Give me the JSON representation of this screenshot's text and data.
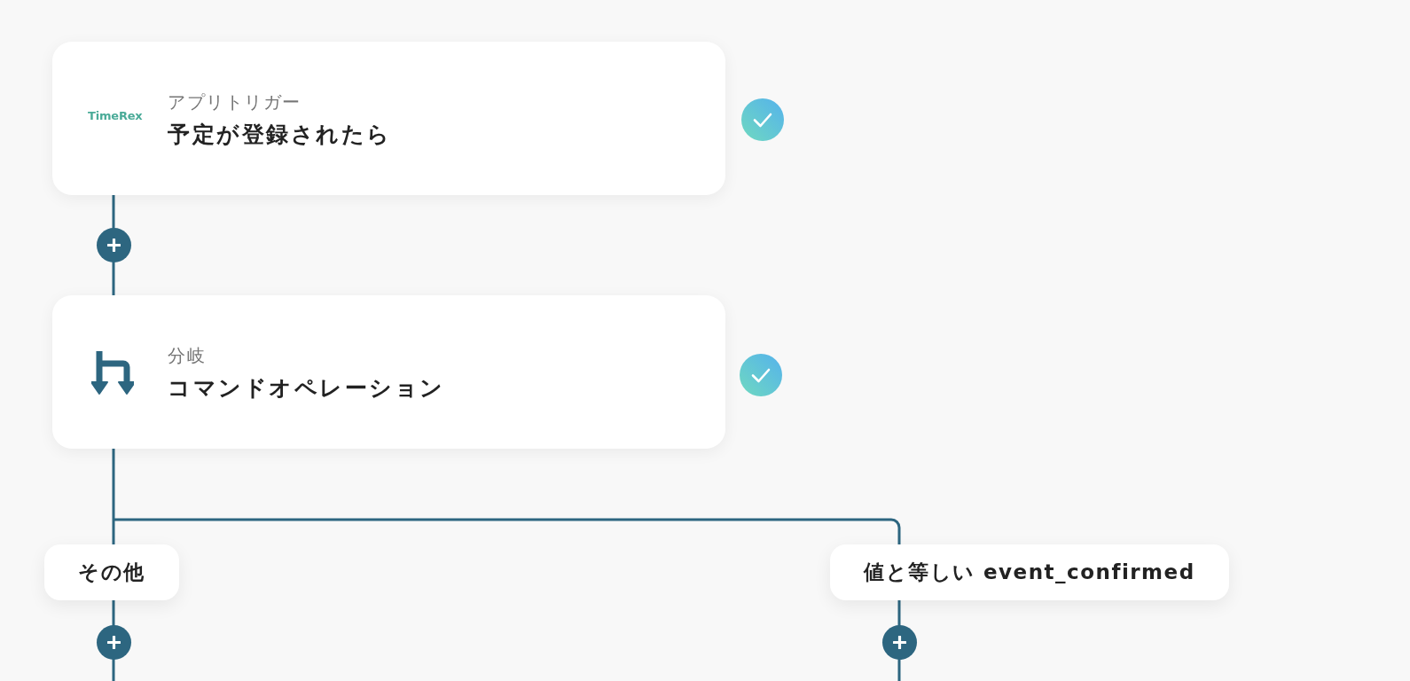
{
  "steps": [
    {
      "kind": "app",
      "logo": "TimeRex",
      "category": "アプリトリガー",
      "title": "予定が登録されたら",
      "completed": true
    },
    {
      "kind": "branch",
      "category": "分岐",
      "title": "コマンドオペレーション",
      "completed": true
    }
  ],
  "branches": [
    {
      "label": "その他"
    },
    {
      "label": "値と等しい event_confirmed"
    }
  ]
}
